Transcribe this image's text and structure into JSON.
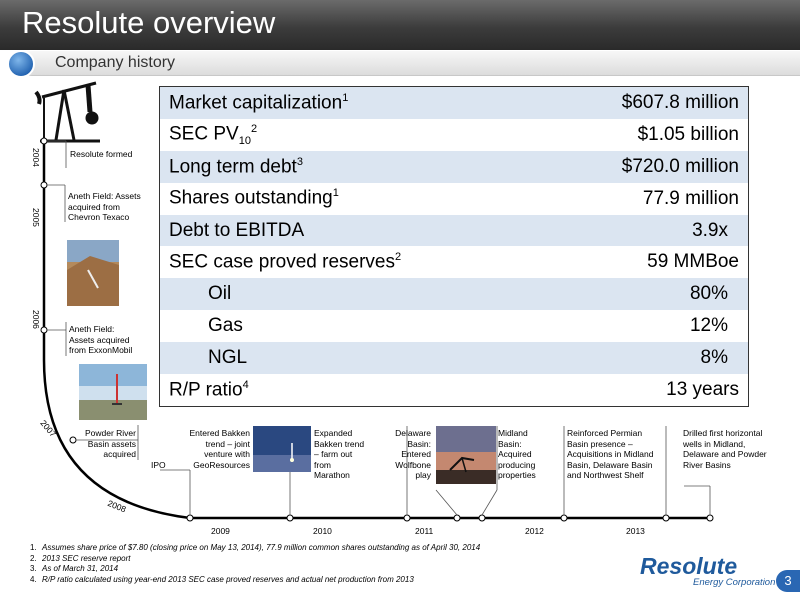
{
  "header": {
    "title": "Resolute overview"
  },
  "subheader": {
    "subtitle": "Company history"
  },
  "metrics": [
    {
      "label": "Market capitalization",
      "sup": "1",
      "value": "$607.8 million"
    },
    {
      "label": "SEC PV",
      "sub": "10",
      "sup": "2",
      "value": "$1.05 billion"
    },
    {
      "label": "Long term debt",
      "sup": "3",
      "value": "$720.0 million"
    },
    {
      "label": "Shares outstanding",
      "sup": "1",
      "value": "77.9 million"
    },
    {
      "label": "Debt to EBITDA",
      "value": "3.9x"
    },
    {
      "label": "SEC case proved reserves",
      "sup": "2",
      "value": "59 MMBoe"
    },
    {
      "label": "Oil",
      "value": "80%"
    },
    {
      "label": "Gas",
      "value": "12%"
    },
    {
      "label": "NGL",
      "value": "8%"
    },
    {
      "label": "R/P ratio",
      "sup": "4",
      "value": "13 years"
    }
  ],
  "timeline": {
    "years_vertical": [
      "2004",
      "2005",
      "2006",
      "2007",
      "2008"
    ],
    "years_horizontal": [
      "2009",
      "2010",
      "2011",
      "2012",
      "2013"
    ],
    "events": {
      "resolute_formed": "Resolute formed",
      "aneth_chevron": "Aneth Field: Assets acquired from Chevron Texaco",
      "aneth_exxon": "Aneth Field: Assets acquired from ExxonMobil",
      "powder_river": "Powder River Basin assets acquired",
      "ipo": "IPO",
      "bakken_jv": "Entered Bakken trend – joint venture with GeoResources",
      "bakken_expanded": "Expanded Bakken trend – farm out from Marathon",
      "delaware": "Delaware Basin: Entered Wolfbone play",
      "midland": "Midland Basin: Acquired producing properties",
      "permian": "Reinforced Permian Basin presence – Acquisitions in Midland Basin, Delaware Basin and Northwest Shelf",
      "horizontal": "Drilled first horizontal wells in Midland, Delaware and Powder River Basins"
    }
  },
  "footnotes": [
    {
      "num": "1.",
      "text": "Assumes share price of $7.80 (closing price on May 13, 2014), 77.9 million common shares outstanding as of April 30, 2014"
    },
    {
      "num": "2.",
      "text": "2013 SEC reserve report"
    },
    {
      "num": "3.",
      "text": "As of March 31, 2014"
    },
    {
      "num": "4.",
      "text": "R/P ratio calculated using year-end 2013 SEC case proved reserves and actual net production from 2013"
    }
  ],
  "logo": {
    "brand": "Resolute",
    "sub": "Energy Corporation"
  },
  "page_number": "3",
  "colors": {
    "table_shade": "#dbe5f1",
    "brand_blue": "#1f5a9c",
    "header_dark": "#3c3c3c"
  }
}
